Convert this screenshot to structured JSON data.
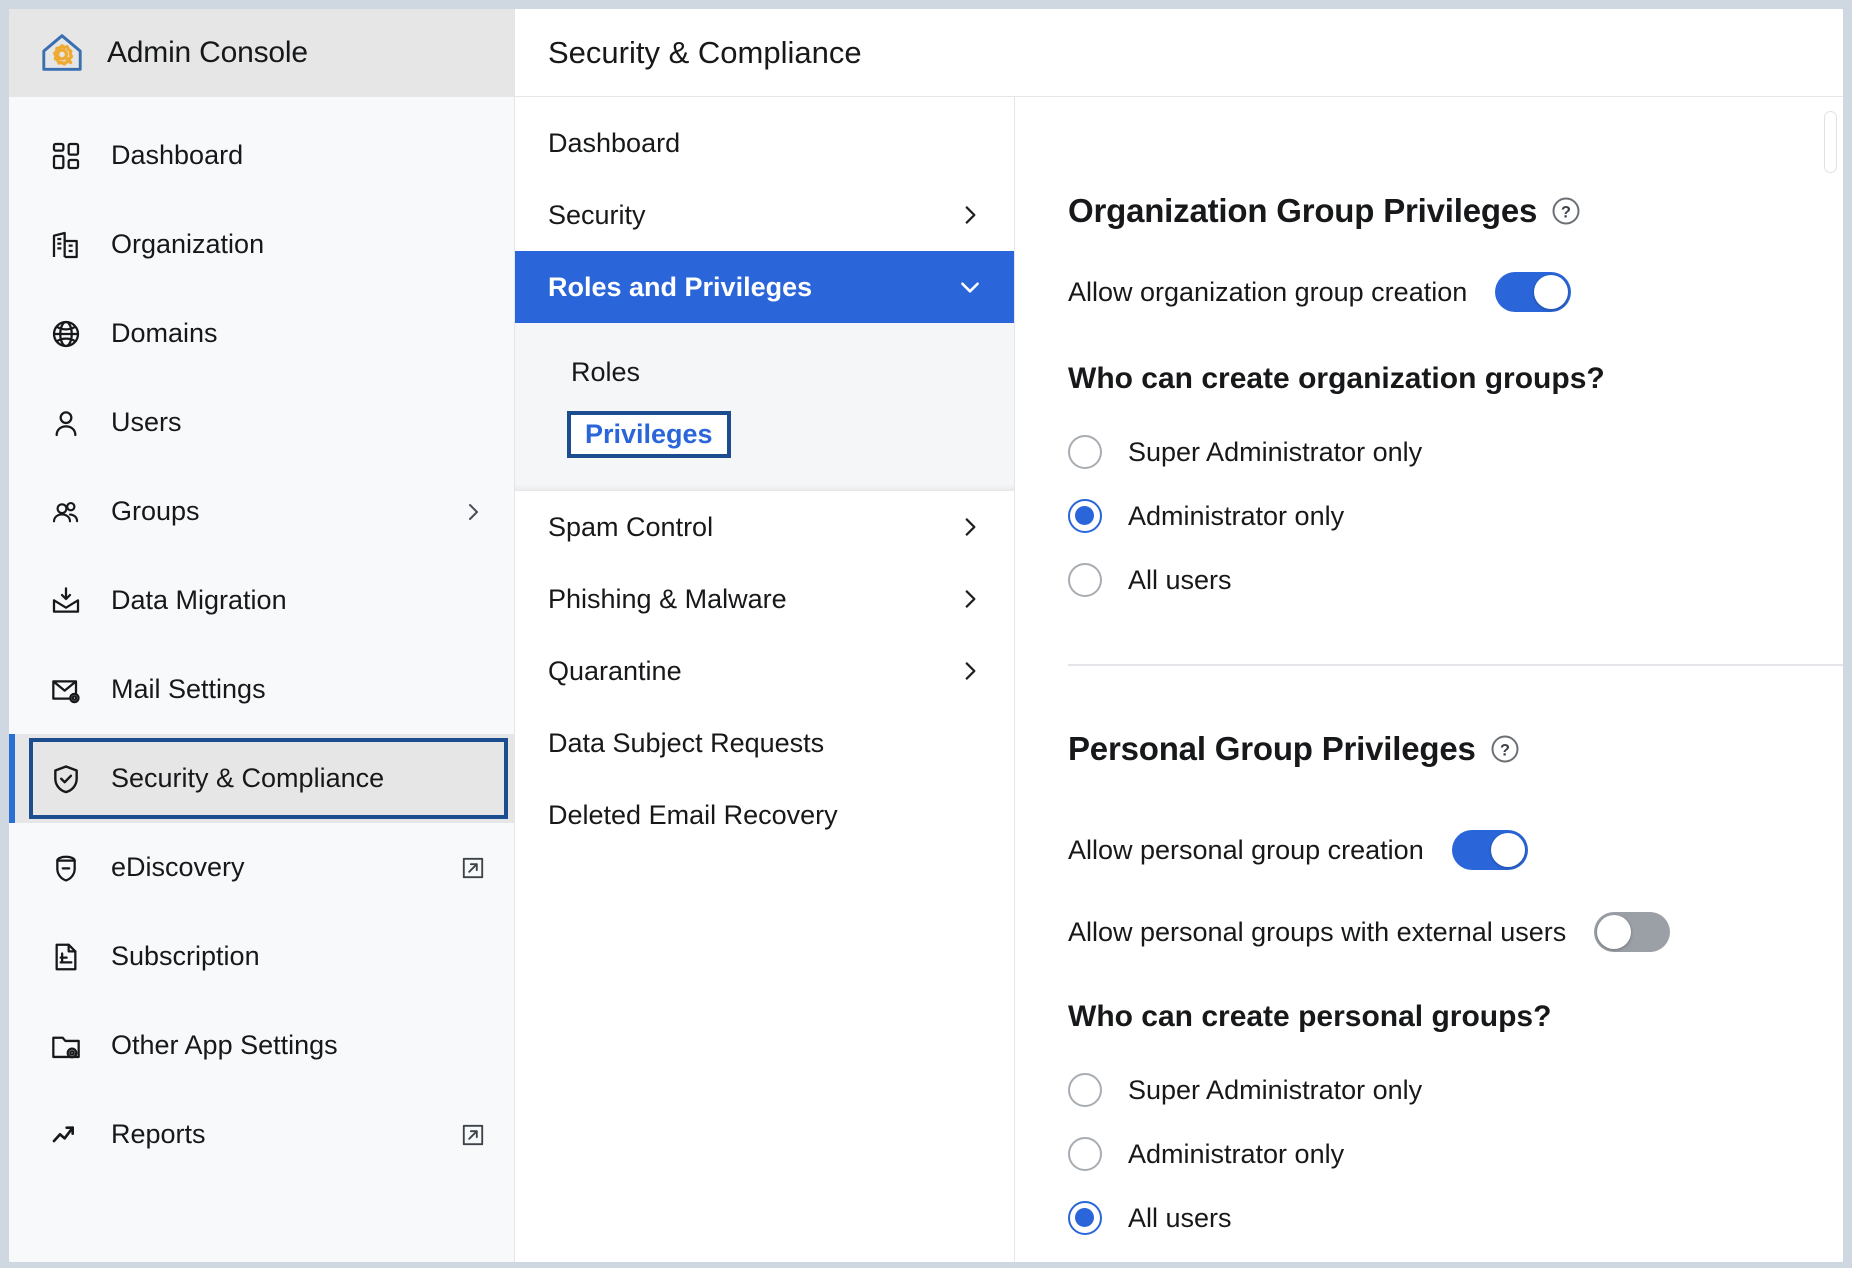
{
  "brand": {
    "title": "Admin Console",
    "icon": "house-gear-icon"
  },
  "sidebar": {
    "items": [
      {
        "label": "Dashboard",
        "icon": "dashboard-icon",
        "trail": "none",
        "state": "default"
      },
      {
        "label": "Organization",
        "icon": "building-icon",
        "trail": "none",
        "state": "default"
      },
      {
        "label": "Domains",
        "icon": "globe-icon",
        "trail": "none",
        "state": "default"
      },
      {
        "label": "Users",
        "icon": "user-icon",
        "trail": "none",
        "state": "default"
      },
      {
        "label": "Groups",
        "icon": "users-group-icon",
        "trail": "chevron-right-icon",
        "state": "default"
      },
      {
        "label": "Data Migration",
        "icon": "inbox-download-icon",
        "trail": "none",
        "state": "default"
      },
      {
        "label": "Mail Settings",
        "icon": "mail-gear-icon",
        "trail": "none",
        "state": "default"
      },
      {
        "label": "Security & Compliance",
        "icon": "shield-check-icon",
        "trail": "none",
        "state": "selected-focused"
      },
      {
        "label": "eDiscovery",
        "icon": "ediscovery-icon",
        "trail": "external-link-icon",
        "state": "default"
      },
      {
        "label": "Subscription",
        "icon": "invoice-icon",
        "trail": "none",
        "state": "default"
      },
      {
        "label": "Other App Settings",
        "icon": "folder-gear-icon",
        "trail": "none",
        "state": "default"
      },
      {
        "label": "Reports",
        "icon": "trend-up-icon",
        "trail": "external-link-icon",
        "state": "default"
      }
    ]
  },
  "header": {
    "title": "Security & Compliance"
  },
  "subnav": {
    "items": [
      {
        "label": "Dashboard",
        "trail": "none",
        "active": false
      },
      {
        "label": "Security",
        "trail": "chevron-right-icon",
        "active": false
      },
      {
        "label": "Roles and Privileges",
        "trail": "chevron-down-icon",
        "active": true
      },
      {
        "label": "Spam Control",
        "trail": "chevron-right-icon",
        "active": false
      },
      {
        "label": "Phishing & Malware",
        "trail": "chevron-right-icon",
        "active": false
      },
      {
        "label": "Quarantine",
        "trail": "chevron-right-icon",
        "active": false
      },
      {
        "label": "Data Subject Requests",
        "trail": "none",
        "active": false
      },
      {
        "label": "Deleted Email Recovery",
        "trail": "none",
        "active": false
      }
    ],
    "children": [
      {
        "label": "Roles",
        "focused": false
      },
      {
        "label": "Privileges",
        "focused": true
      }
    ]
  },
  "content": {
    "org_section": {
      "title": "Organization Group Privileges",
      "help_icon": "help-circle-icon",
      "toggle": {
        "label": "Allow organization group creation",
        "on": true
      },
      "question": "Who can create organization groups?",
      "options": [
        {
          "label": "Super Administrator only",
          "checked": false
        },
        {
          "label": "Administrator only",
          "checked": true
        },
        {
          "label": "All users",
          "checked": false
        }
      ]
    },
    "personal_section": {
      "title": "Personal Group Privileges",
      "help_icon": "help-circle-icon",
      "toggles": [
        {
          "label": "Allow personal group creation",
          "on": true
        },
        {
          "label": "Allow personal groups with external users",
          "on": false
        }
      ],
      "question": "Who can create personal groups?",
      "options": [
        {
          "label": "Super Administrator only",
          "checked": false
        },
        {
          "label": "Administrator only",
          "checked": false
        },
        {
          "label": "All users",
          "checked": true
        }
      ]
    }
  },
  "colors": {
    "accent_blue": "#2a66d9",
    "focus_navy": "#1c4e8f",
    "selected_bg": "#e6e6e6",
    "sidebar_bg": "#f7f9fb",
    "toggle_off": "#9ba0a6",
    "brand_house": "#3a6fb0",
    "brand_gear": "#eeaa33"
  }
}
